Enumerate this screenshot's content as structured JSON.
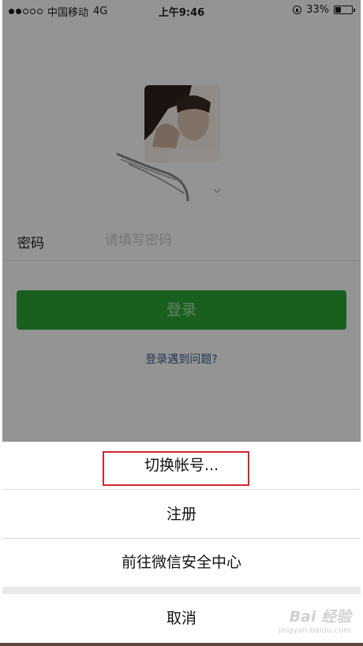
{
  "status_bar": {
    "carrier": "中国移动",
    "network": "4G",
    "time": "上午9:46",
    "battery_percent": "33%",
    "battery_level": 0.33
  },
  "login": {
    "password_label": "密码",
    "password_placeholder": "请填写密码",
    "password_value": "",
    "login_button": "登录",
    "help_link": "登录遇到问题?"
  },
  "action_sheet": {
    "items": [
      {
        "label": "切换帐号...",
        "highlighted": true
      },
      {
        "label": "注册"
      },
      {
        "label": "前往微信安全中心"
      }
    ],
    "cancel": "取消"
  },
  "watermark": {
    "main": "Bai 经验",
    "sub": "jingyan.baidu.com"
  },
  "colors": {
    "accent_green": "#2aa034",
    "link_blue": "#3a5a8a",
    "highlight_red": "#d0262d"
  }
}
